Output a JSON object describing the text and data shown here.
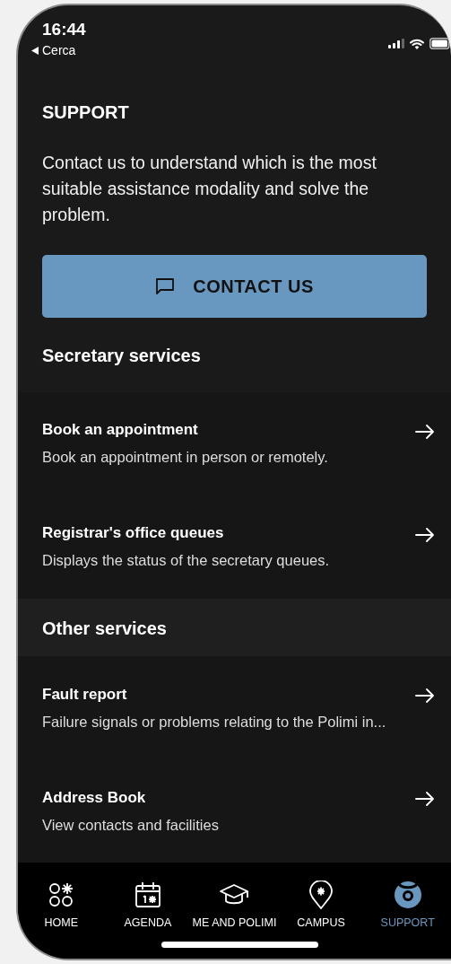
{
  "status_bar": {
    "time": "16:44",
    "back_link": "Cerca"
  },
  "header": {
    "title": "SUPPORT",
    "description": "Contact us to understand which is the most suitable assistance modality and solve the problem."
  },
  "contact_button": {
    "label": "CONTACT US"
  },
  "sections": [
    {
      "title": "Secretary services",
      "items": [
        {
          "title": "Book an appointment",
          "subtitle": "Book an appointment in person or remotely."
        },
        {
          "title": "Registrar's office queues",
          "subtitle": "Displays the status of the secretary queues."
        }
      ]
    },
    {
      "title": "Other services",
      "items": [
        {
          "title": "Fault report",
          "subtitle": "Failure signals or problems relating to the Polimi in..."
        },
        {
          "title": "Address Book",
          "subtitle": "View contacts and facilities"
        }
      ]
    }
  ],
  "tab_bar": [
    {
      "kind": "home",
      "label": "HOME",
      "selected": false
    },
    {
      "kind": "agenda",
      "label": "AGENDA",
      "selected": false
    },
    {
      "kind": "polimi",
      "label": "ME AND POLIMI",
      "selected": false
    },
    {
      "kind": "campus",
      "label": "CAMPUS",
      "selected": false
    },
    {
      "kind": "support",
      "label": "SUPPORT",
      "selected": true
    }
  ]
}
